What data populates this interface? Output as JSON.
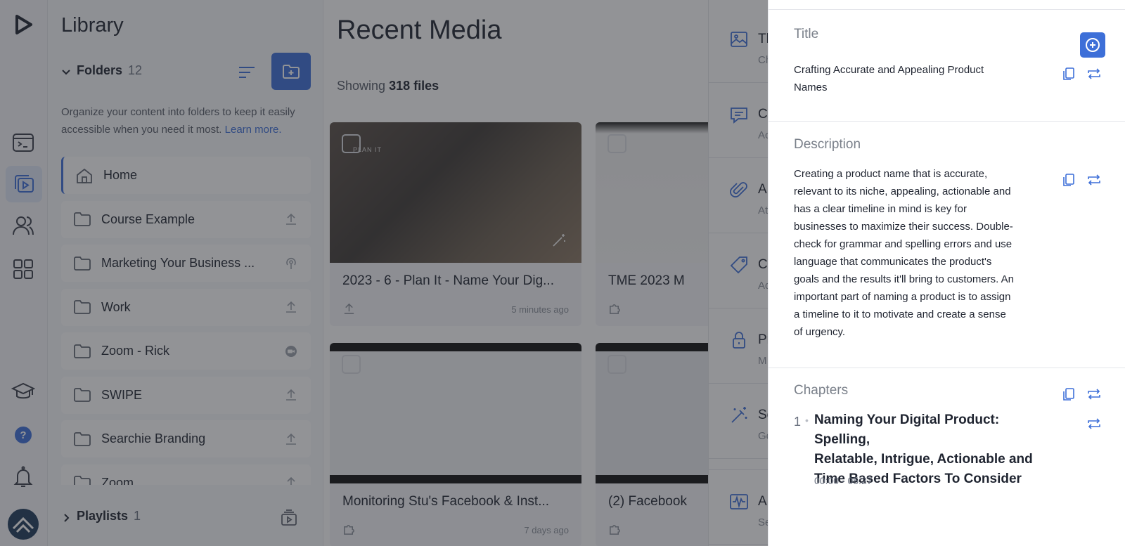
{
  "sidebar_rail": {
    "icons": [
      "app-logo-icon",
      "video-dashboard-icon",
      "media-library-icon",
      "users-icon",
      "apps-grid-icon",
      "graduation-cap-icon",
      "help-icon",
      "notification-bell-icon",
      "brand-logo-icon"
    ],
    "help_glyph": "?"
  },
  "library": {
    "title": "Library",
    "folders_label": "Folders",
    "folders_count": "12",
    "description": "Organize your content into folders to keep it easily accessible when you need it most.",
    "learn_more": "Learn more.",
    "folders": [
      {
        "label": "Home",
        "trail_icon": ""
      },
      {
        "label": "Course Example",
        "trail_icon": "upload-icon"
      },
      {
        "label": "Marketing Your Business ...",
        "trail_icon": "podcast-icon"
      },
      {
        "label": "Work",
        "trail_icon": "upload-icon"
      },
      {
        "label": "Zoom - Rick",
        "trail_icon": "zoom-icon"
      },
      {
        "label": "SWIPE",
        "trail_icon": "upload-icon"
      },
      {
        "label": "Searchie Branding",
        "trail_icon": "upload-icon"
      },
      {
        "label": "Zoom",
        "trail_icon": "upload-icon"
      }
    ],
    "playlists_label": "Playlists",
    "playlists_count": "1"
  },
  "main": {
    "title": "Recent Media",
    "showing_prefix": "Showing",
    "showing_count": "318 files",
    "cards": [
      {
        "title": "2023 - 6 - Plan It - Name Your Dig...",
        "time": "5 minutes ago",
        "thumb_caption": "PLAN IT",
        "icon": "upload-icon"
      },
      {
        "title": "TME 2023 M",
        "time": "",
        "icon": "puzzle-icon"
      },
      {
        "title": "Monitoring Stu's Facebook & Inst...",
        "time": "7 days ago",
        "icon": "puzzle-icon"
      },
      {
        "title": "(2) Facebook",
        "time": "",
        "icon": "puzzle-icon"
      }
    ]
  },
  "side_panel": {
    "items": [
      {
        "label": "Th",
        "sub": "Ch",
        "icon": "image-icon"
      },
      {
        "label": "C",
        "sub": "Ac",
        "icon": "comment-icon"
      },
      {
        "label": "A",
        "sub": "At",
        "icon": "paperclip-icon"
      },
      {
        "label": "C",
        "sub": "Ad",
        "icon": "tag-icon"
      },
      {
        "label": "Pr",
        "sub": "M",
        "icon": "lock-icon"
      },
      {
        "label": "Se",
        "sub": "Ge",
        "icon": "magic-wand-icon"
      },
      {
        "label": "A",
        "sub": "Se",
        "icon": "waveform-icon"
      }
    ]
  },
  "drawer": {
    "title_label": "Title",
    "title_value_line1": "Crafting Accurate and Appealing Product",
    "title_value_line2": "Names",
    "description_label": "Description",
    "description_lines": [
      "Creating a product name that is accurate,",
      "relevant to its niche, appealing, actionable and",
      "has a clear timeline in mind is key for",
      "businesses to maximize their success. Double-",
      "check for grammar and spelling errors and use",
      "language that communicates the product's",
      "goals and the results it'll bring to customers. An",
      "important part of naming a product is to assign",
      "a timeline to it to motivate and create a sense",
      "of urgency."
    ],
    "chapters_label": "Chapters",
    "chapter": {
      "number": "1",
      "dot": "•",
      "title_lines": [
        "Naming Your Digital Product: Spelling,",
        "Relatable, Intrigue, Actionable and",
        "Time Based Factors To Consider"
      ],
      "time": "00:00 - 05:27"
    }
  },
  "colors": {
    "accent": "#3d6fd8",
    "overlay": "rgba(38,40,46,0.5)"
  }
}
